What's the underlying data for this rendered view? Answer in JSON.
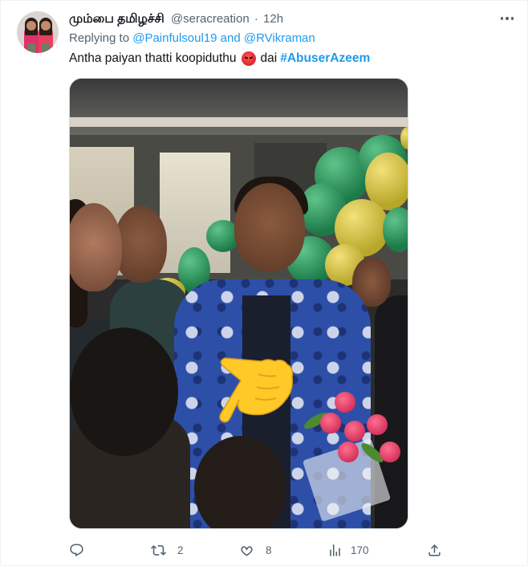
{
  "tweet": {
    "display_name": "மும்பை தமிழச்சி",
    "handle": "@seracreation",
    "separator": "·",
    "time": "12h",
    "replying_prefix": "Replying to",
    "replying_users": "@Painfulsoul19 and @RVikraman",
    "text_before_emoji": "Antha paiyan thatti koopiduthu",
    "emoji": "angry-face-emoji",
    "text_after_emoji": "dai",
    "hashtag": "#AbuserAzeem",
    "media_description": "video-thumbnail"
  },
  "actions": {
    "reply_count": "",
    "retweet_count": "2",
    "like_count": "8",
    "views_count": "170"
  },
  "colors": {
    "link": "#1d9bf0",
    "secondary_text": "#536471",
    "primary_text": "#0f1419"
  }
}
